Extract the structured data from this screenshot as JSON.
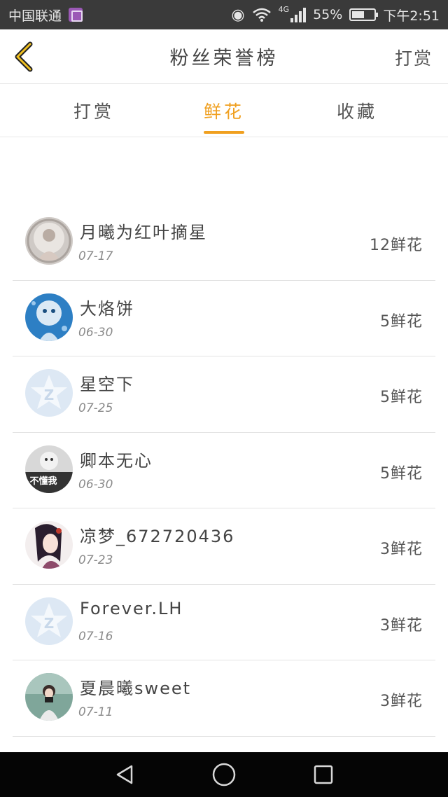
{
  "status_bar": {
    "carrier": "中国联通",
    "network": "4G",
    "battery_percent": "55%",
    "battery_level": 0.55,
    "time": "下午2:51"
  },
  "header": {
    "title": "粉丝荣誉榜",
    "action_label": "打赏"
  },
  "tabs": [
    {
      "label": "打赏",
      "active": false
    },
    {
      "label": "鲜花",
      "active": true
    },
    {
      "label": "收藏",
      "active": false
    }
  ],
  "accent_color": "#f0a020",
  "rankings": [
    {
      "name": "月曦为红叶摘星",
      "date": "07-17",
      "count": "12鲜花",
      "avatar": "photo-avatar-light"
    },
    {
      "name": "大烙饼",
      "date": "06-30",
      "count": "5鲜花",
      "avatar": "cartoon-blue-avatar"
    },
    {
      "name": "星空下",
      "date": "07-25",
      "count": "5鲜花",
      "avatar": "default-qzone-avatar"
    },
    {
      "name": "卿本无心",
      "date": "06-30",
      "count": "5鲜花",
      "avatar": "meme-avatar",
      "avatar_text": "不懂我"
    },
    {
      "name": "凉梦_672720436",
      "date": "07-23",
      "count": "3鲜花",
      "avatar": "anime-girl-avatar"
    },
    {
      "name": "Forever.LH",
      "date": "07-16",
      "count": "3鲜花",
      "avatar": "default-qzone-avatar"
    },
    {
      "name": "夏晨曦sweet",
      "date": "07-11",
      "count": "3鲜花",
      "avatar": "photo-avatar-outdoor"
    }
  ]
}
